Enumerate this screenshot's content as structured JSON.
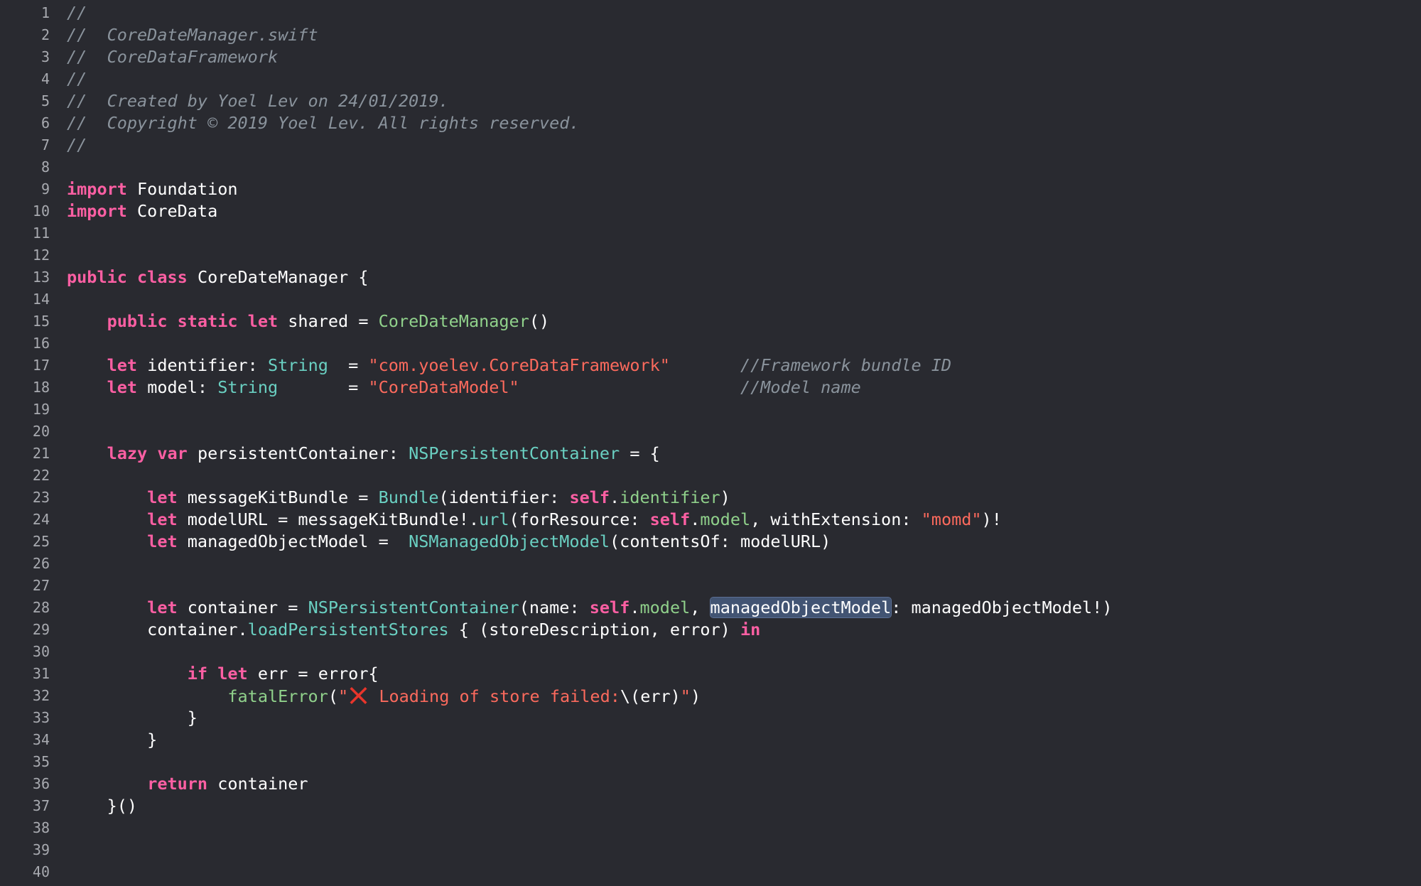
{
  "editor": {
    "lines": [
      {
        "n": "1",
        "tokens": [
          {
            "t": "//",
            "c": "cm"
          }
        ]
      },
      {
        "n": "2",
        "tokens": [
          {
            "t": "//  CoreDateManager.swift",
            "c": "cm"
          }
        ]
      },
      {
        "n": "3",
        "tokens": [
          {
            "t": "//  CoreDataFramework",
            "c": "cm"
          }
        ]
      },
      {
        "n": "4",
        "tokens": [
          {
            "t": "//",
            "c": "cm"
          }
        ]
      },
      {
        "n": "5",
        "tokens": [
          {
            "t": "//  Created by Yoel Lev on 24/01/2019.",
            "c": "cm"
          }
        ]
      },
      {
        "n": "6",
        "tokens": [
          {
            "t": "//  Copyright © 2019 Yoel Lev. All rights reserved.",
            "c": "cm"
          }
        ]
      },
      {
        "n": "7",
        "tokens": [
          {
            "t": "//",
            "c": "cm"
          }
        ]
      },
      {
        "n": "8",
        "tokens": []
      },
      {
        "n": "9",
        "tokens": [
          {
            "t": "import",
            "c": "kw"
          },
          {
            "t": " Foundation",
            "c": "pl"
          }
        ]
      },
      {
        "n": "10",
        "tokens": [
          {
            "t": "import",
            "c": "kw"
          },
          {
            "t": " CoreData",
            "c": "pl"
          }
        ]
      },
      {
        "n": "11",
        "tokens": []
      },
      {
        "n": "12",
        "tokens": []
      },
      {
        "n": "13",
        "tokens": [
          {
            "t": "public",
            "c": "kw"
          },
          {
            "t": " ",
            "c": "pl"
          },
          {
            "t": "class",
            "c": "kw"
          },
          {
            "t": " CoreDateManager {",
            "c": "pl"
          }
        ]
      },
      {
        "n": "14",
        "tokens": []
      },
      {
        "n": "15",
        "tokens": [
          {
            "t": "    ",
            "c": "pl"
          },
          {
            "t": "public",
            "c": "kw"
          },
          {
            "t": " ",
            "c": "pl"
          },
          {
            "t": "static",
            "c": "kw"
          },
          {
            "t": " ",
            "c": "pl"
          },
          {
            "t": "let",
            "c": "kw"
          },
          {
            "t": " shared = ",
            "c": "pl"
          },
          {
            "t": "CoreDateManager",
            "c": "fn"
          },
          {
            "t": "()",
            "c": "pl"
          }
        ]
      },
      {
        "n": "16",
        "tokens": []
      },
      {
        "n": "17",
        "tokens": [
          {
            "t": "    ",
            "c": "pl"
          },
          {
            "t": "let",
            "c": "kw"
          },
          {
            "t": " identifier: ",
            "c": "pl"
          },
          {
            "t": "String",
            "c": "ty"
          },
          {
            "t": "  = ",
            "c": "pl"
          },
          {
            "t": "\"com.yoelev.CoreDataFramework\"",
            "c": "str"
          },
          {
            "t": "       ",
            "c": "pl"
          },
          {
            "t": "//Framework bundle ID",
            "c": "cm"
          }
        ]
      },
      {
        "n": "18",
        "tokens": [
          {
            "t": "    ",
            "c": "pl"
          },
          {
            "t": "let",
            "c": "kw"
          },
          {
            "t": " model: ",
            "c": "pl"
          },
          {
            "t": "String",
            "c": "ty"
          },
          {
            "t": "       = ",
            "c": "pl"
          },
          {
            "t": "\"CoreDataModel\"",
            "c": "str"
          },
          {
            "t": "                      ",
            "c": "pl"
          },
          {
            "t": "//Model name",
            "c": "cm"
          }
        ]
      },
      {
        "n": "19",
        "tokens": []
      },
      {
        "n": "20",
        "tokens": []
      },
      {
        "n": "21",
        "tokens": [
          {
            "t": "    ",
            "c": "pl"
          },
          {
            "t": "lazy",
            "c": "kw"
          },
          {
            "t": " ",
            "c": "pl"
          },
          {
            "t": "var",
            "c": "kw"
          },
          {
            "t": " persistentContainer: ",
            "c": "pl"
          },
          {
            "t": "NSPersistentContainer",
            "c": "ty"
          },
          {
            "t": " = {",
            "c": "pl"
          }
        ]
      },
      {
        "n": "22",
        "tokens": []
      },
      {
        "n": "23",
        "tokens": [
          {
            "t": "        ",
            "c": "pl"
          },
          {
            "t": "let",
            "c": "kw"
          },
          {
            "t": " messageKitBundle = ",
            "c": "pl"
          },
          {
            "t": "Bundle",
            "c": "ty"
          },
          {
            "t": "(identifier: ",
            "c": "pl"
          },
          {
            "t": "self",
            "c": "kw"
          },
          {
            "t": ".",
            "c": "pl"
          },
          {
            "t": "identifier",
            "c": "fn"
          },
          {
            "t": ")",
            "c": "pl"
          }
        ]
      },
      {
        "n": "24",
        "tokens": [
          {
            "t": "        ",
            "c": "pl"
          },
          {
            "t": "let",
            "c": "kw"
          },
          {
            "t": " modelURL = messageKitBundle!.",
            "c": "pl"
          },
          {
            "t": "url",
            "c": "ty"
          },
          {
            "t": "(forResource: ",
            "c": "pl"
          },
          {
            "t": "self",
            "c": "kw"
          },
          {
            "t": ".",
            "c": "pl"
          },
          {
            "t": "model",
            "c": "fn"
          },
          {
            "t": ", withExtension: ",
            "c": "pl"
          },
          {
            "t": "\"momd\"",
            "c": "str"
          },
          {
            "t": ")!",
            "c": "pl"
          }
        ]
      },
      {
        "n": "25",
        "tokens": [
          {
            "t": "        ",
            "c": "pl"
          },
          {
            "t": "let",
            "c": "kw"
          },
          {
            "t": " managedObjectModel =  ",
            "c": "pl"
          },
          {
            "t": "NSManagedObjectModel",
            "c": "ty"
          },
          {
            "t": "(contentsOf: modelURL)",
            "c": "pl"
          }
        ]
      },
      {
        "n": "26",
        "tokens": []
      },
      {
        "n": "27",
        "tokens": []
      },
      {
        "n": "28",
        "tokens": [
          {
            "t": "        ",
            "c": "pl"
          },
          {
            "t": "let",
            "c": "kw"
          },
          {
            "t": " container = ",
            "c": "pl"
          },
          {
            "t": "NSPersistentContainer",
            "c": "ty"
          },
          {
            "t": "(name: ",
            "c": "pl"
          },
          {
            "t": "self",
            "c": "kw"
          },
          {
            "t": ".",
            "c": "pl"
          },
          {
            "t": "model",
            "c": "fn"
          },
          {
            "t": ", ",
            "c": "pl"
          },
          {
            "t": "managedObjectModel",
            "c": "pl hl"
          },
          {
            "t": ": managedObjectModel!)",
            "c": "pl"
          }
        ]
      },
      {
        "n": "29",
        "tokens": [
          {
            "t": "        container.",
            "c": "pl"
          },
          {
            "t": "loadPersistentStores",
            "c": "ty"
          },
          {
            "t": " { (storeDescription, error) ",
            "c": "pl"
          },
          {
            "t": "in",
            "c": "kw"
          }
        ]
      },
      {
        "n": "30",
        "tokens": []
      },
      {
        "n": "31",
        "tokens": [
          {
            "t": "            ",
            "c": "pl"
          },
          {
            "t": "if",
            "c": "kw"
          },
          {
            "t": " ",
            "c": "pl"
          },
          {
            "t": "let",
            "c": "kw"
          },
          {
            "t": " err = error{",
            "c": "pl"
          }
        ]
      },
      {
        "n": "32",
        "tokens": [
          {
            "t": "                ",
            "c": "pl"
          },
          {
            "t": "fatalError",
            "c": "fn"
          },
          {
            "t": "(",
            "c": "pl"
          },
          {
            "t": "\"",
            "c": "str"
          },
          {
            "t": "",
            "c": "icon"
          },
          {
            "t": " Loading of store failed:",
            "c": "str"
          },
          {
            "t": "\\(",
            "c": "pl"
          },
          {
            "t": "err",
            "c": "pl"
          },
          {
            "t": ")",
            "c": "pl"
          },
          {
            "t": "\"",
            "c": "str"
          },
          {
            "t": ")",
            "c": "pl"
          }
        ]
      },
      {
        "n": "33",
        "tokens": [
          {
            "t": "            }",
            "c": "pl"
          }
        ]
      },
      {
        "n": "34",
        "tokens": [
          {
            "t": "        }",
            "c": "pl"
          }
        ]
      },
      {
        "n": "35",
        "tokens": []
      },
      {
        "n": "36",
        "tokens": [
          {
            "t": "        ",
            "c": "pl"
          },
          {
            "t": "return",
            "c": "kw"
          },
          {
            "t": " container",
            "c": "pl"
          }
        ]
      },
      {
        "n": "37",
        "tokens": [
          {
            "t": "    }()",
            "c": "pl"
          }
        ]
      },
      {
        "n": "38",
        "tokens": []
      },
      {
        "n": "39",
        "tokens": []
      },
      {
        "n": "40",
        "tokens": []
      }
    ]
  },
  "colors": {
    "background": "#292a30",
    "keyword": "#fc5fa3",
    "comment": "#8a939c",
    "string": "#fc6a5d",
    "type": "#6ad0c2",
    "function": "#90d18b",
    "plain": "#ffffff",
    "highlight": "#425473",
    "error_icon": "#e8352b"
  },
  "icons": {
    "error_mark": "cross-mark-icon"
  }
}
